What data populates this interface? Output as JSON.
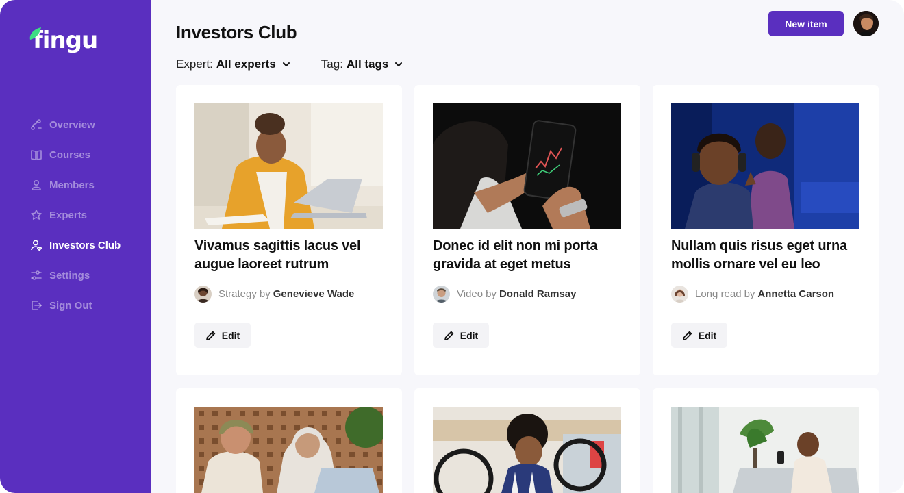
{
  "brand": {
    "name": "fingu",
    "leaf_color": "#3ddc84"
  },
  "sidebar": {
    "items": [
      {
        "label": "Overview",
        "icon": "overview-icon",
        "active": false
      },
      {
        "label": "Courses",
        "icon": "book-icon",
        "active": false
      },
      {
        "label": "Members",
        "icon": "user-icon",
        "active": false
      },
      {
        "label": "Experts",
        "icon": "star-icon",
        "active": false
      },
      {
        "label": "Investors Club",
        "icon": "user-heart-icon",
        "active": true
      },
      {
        "label": "Settings",
        "icon": "sliders-icon",
        "active": false
      },
      {
        "label": "Sign Out",
        "icon": "sign-out-icon",
        "active": false
      }
    ]
  },
  "header": {
    "title": "Investors Club",
    "new_item_label": "New item"
  },
  "filters": {
    "expert": {
      "label": "Expert:",
      "value": "All experts"
    },
    "tag": {
      "label": "Tag:",
      "value": "All tags"
    }
  },
  "cards": [
    {
      "title": "Vivamus sagittis lacus vel augue laoreet rutrum",
      "type": "Strategy",
      "by": "by",
      "author": "Genevieve Wade",
      "edit_label": "Edit"
    },
    {
      "title": "Donec id elit non mi porta gravida at eget metus",
      "type": "Video",
      "by": "by",
      "author": "Donald Ramsay",
      "edit_label": "Edit"
    },
    {
      "title": "Nullam quis risus eget urna mollis ornare vel eu leo",
      "type": "Long read",
      "by": "by",
      "author": "Annetta Carson",
      "edit_label": "Edit"
    }
  ],
  "colors": {
    "primary": "#5a2fbf",
    "background": "#f7f7fb"
  }
}
